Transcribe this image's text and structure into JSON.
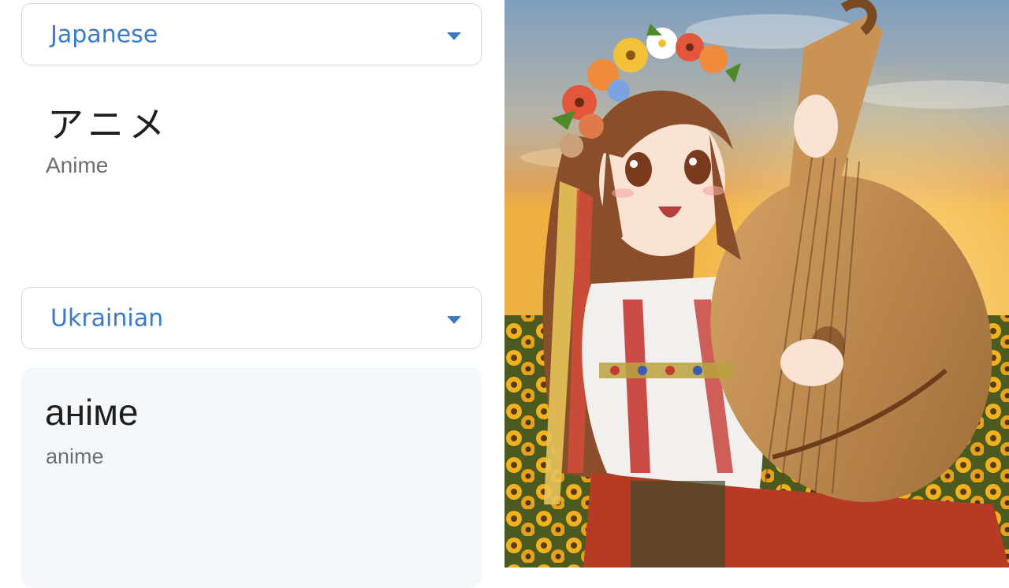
{
  "source": {
    "language": "Japanese",
    "text": "アニメ",
    "transliteration": "Anime"
  },
  "target": {
    "language": "Ukrainian",
    "text": "аніме",
    "transliteration": "anime"
  },
  "icons": {
    "dropdown": "chevron-down-icon"
  },
  "colors": {
    "accent": "#3a7ac9",
    "target_box_bg": "#f5f8fb",
    "border": "#d7d9dc"
  }
}
